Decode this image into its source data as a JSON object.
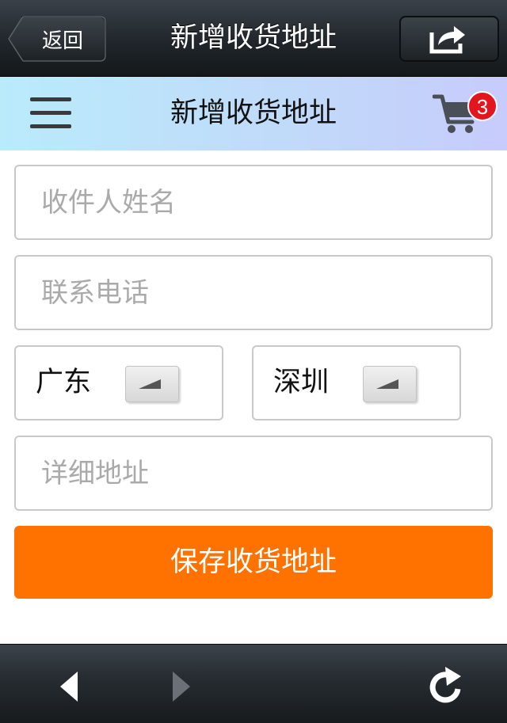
{
  "topbar": {
    "back_label": "返回",
    "title": "新增收货地址",
    "share_icon": "share-icon"
  },
  "subheader": {
    "menu_icon": "menu-icon",
    "title": "新增收货地址",
    "cart_icon": "cart-icon",
    "cart_count": "3"
  },
  "form": {
    "name_placeholder": "收件人姓名",
    "name_value": "",
    "phone_placeholder": "联系电话",
    "phone_value": "",
    "province_selected": "广东",
    "city_selected": "深圳",
    "address_placeholder": "详细地址",
    "address_value": "",
    "save_label": "保存收货地址"
  },
  "bottombar": {
    "back_icon": "back-arrow-icon",
    "forward_icon": "forward-arrow-icon",
    "refresh_icon": "refresh-icon"
  },
  "colors": {
    "accent_orange": "#ff7200",
    "badge_red": "#e3161d",
    "header_dark": "#20262b"
  }
}
